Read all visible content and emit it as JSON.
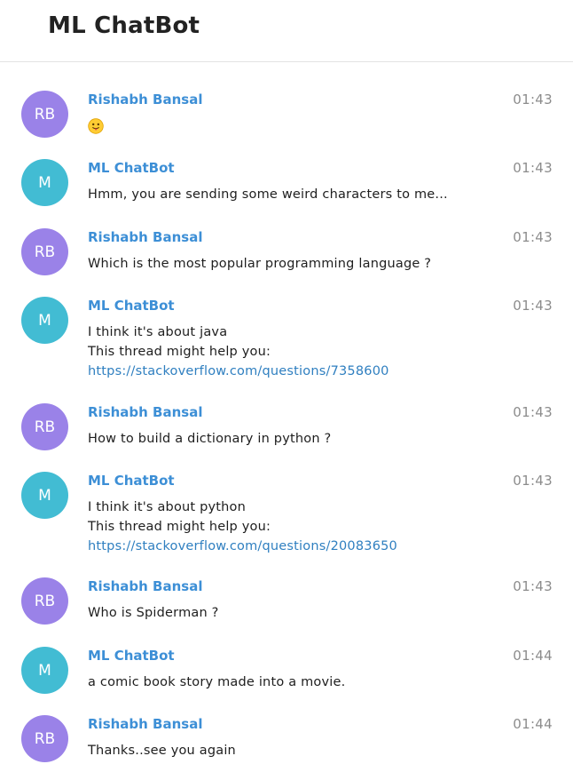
{
  "app": {
    "title": "ML ChatBot"
  },
  "colors": {
    "user_avatar": "#9a82e8",
    "bot_avatar": "#42bcd3",
    "sender_name": "#3d8fd6",
    "link": "#2f7fc0",
    "timestamp": "#8c8c8c"
  },
  "messages": [
    {
      "sender": "Rishabh Bansal",
      "initials": "RB",
      "role": "user",
      "time": "01:43",
      "lines": [],
      "emoji": "face-with-tongue-icon"
    },
    {
      "sender": "ML ChatBot",
      "initials": "M",
      "role": "bot",
      "time": "01:43",
      "lines": [
        "Hmm, you are sending some weird characters to me..."
      ]
    },
    {
      "sender": "Rishabh Bansal",
      "initials": "RB",
      "role": "user",
      "time": "01:43",
      "lines": [
        "Which is the most popular programming language ?"
      ]
    },
    {
      "sender": "ML ChatBot",
      "initials": "M",
      "role": "bot",
      "time": "01:43",
      "lines": [
        "I think it's about java",
        "This thread might help you:"
      ],
      "link": "https://stackoverflow.com/questions/7358600"
    },
    {
      "sender": "Rishabh Bansal",
      "initials": "RB",
      "role": "user",
      "time": "01:43",
      "lines": [
        "How to build a dictionary in python ?"
      ]
    },
    {
      "sender": "ML ChatBot",
      "initials": "M",
      "role": "bot",
      "time": "01:43",
      "lines": [
        "I think it's about python",
        "This thread might help you:"
      ],
      "link": "https://stackoverflow.com/questions/20083650"
    },
    {
      "sender": "Rishabh Bansal",
      "initials": "RB",
      "role": "user",
      "time": "01:43",
      "lines": [
        "Who is Spiderman ?"
      ]
    },
    {
      "sender": "ML ChatBot",
      "initials": "M",
      "role": "bot",
      "time": "01:44",
      "lines": [
        "a comic book story made into a movie."
      ]
    },
    {
      "sender": "Rishabh Bansal",
      "initials": "RB",
      "role": "user",
      "time": "01:44",
      "lines": [
        "Thanks..see you again"
      ]
    }
  ]
}
